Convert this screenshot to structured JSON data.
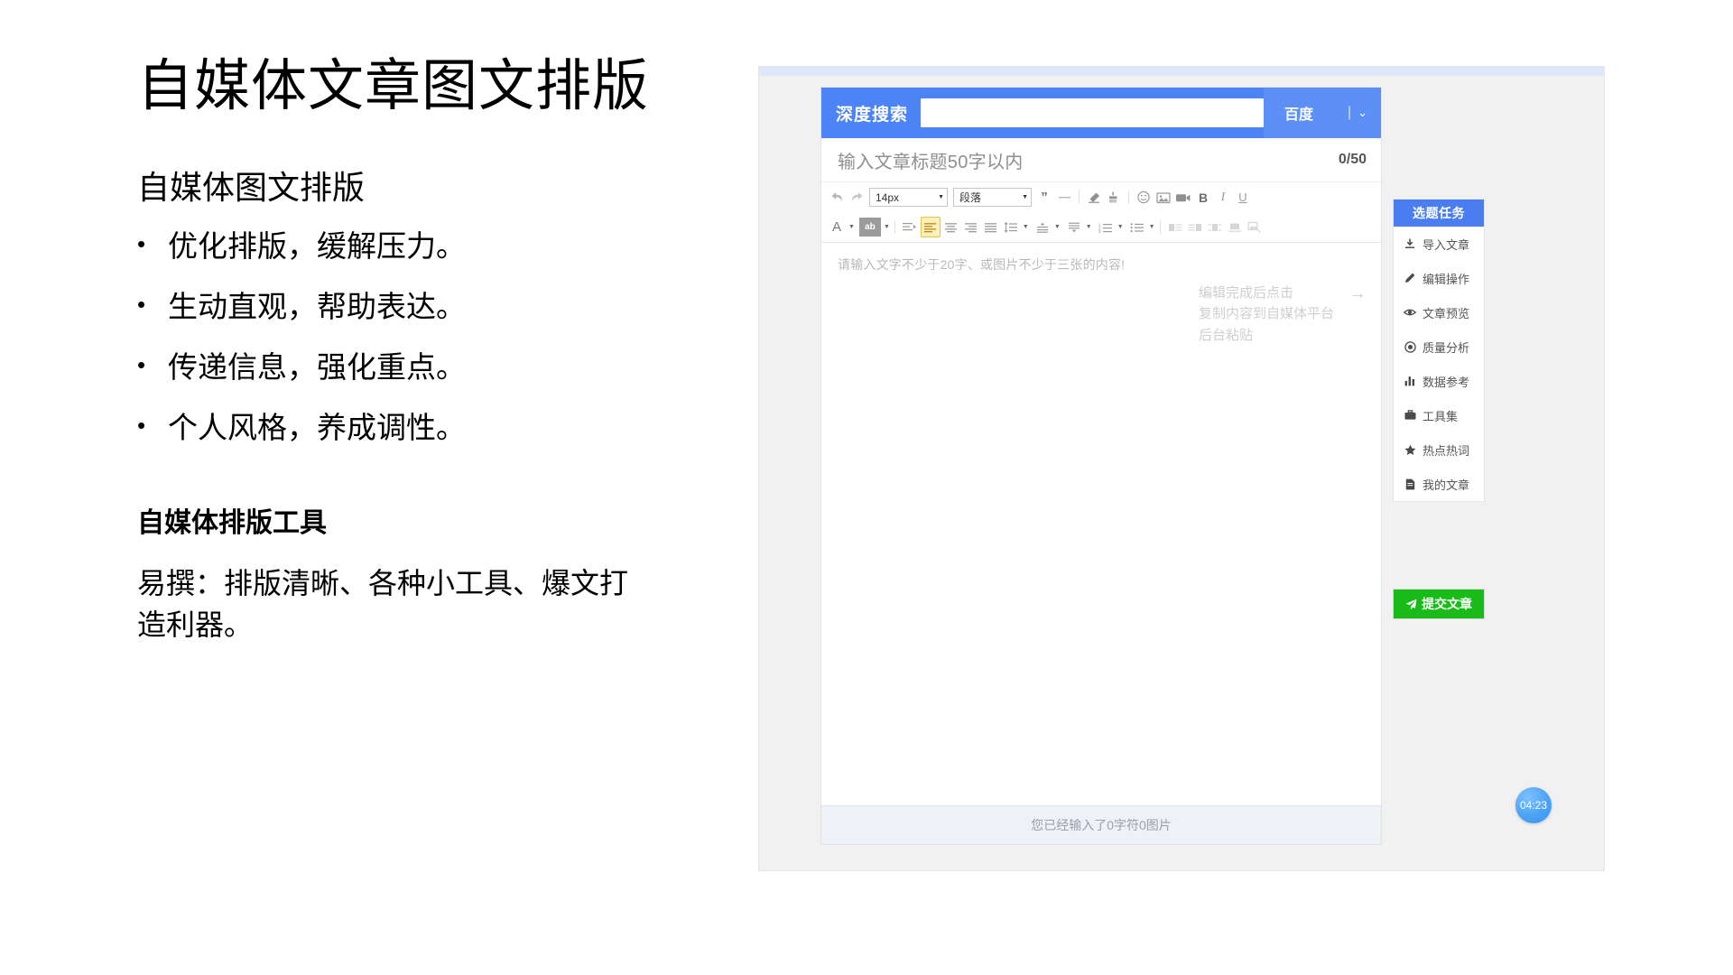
{
  "slide": {
    "title": "自媒体文章图文排版",
    "section_heading": "自媒体图文排版",
    "bullets": [
      "优化排版，缓解压力。",
      "生动直观，帮助表达。",
      "传递信息，强化重点。",
      "个人风格，养成调性。"
    ],
    "bullet_marker": "•",
    "tool_heading": "自媒体排版工具",
    "tool_desc": "易撰：排版清晰、各种小工具、爆文打造利器。"
  },
  "app": {
    "search_header": {
      "brand": "深度搜索",
      "input_value": "",
      "input_placeholder": "",
      "search_button": "百度",
      "divider": "|",
      "chevron": "⌄"
    },
    "title_row": {
      "placeholder": "输入文章标题50字以内",
      "counter": "0/50"
    },
    "toolbar_row1": [
      {
        "name": "undo-icon",
        "label": "↶"
      },
      {
        "name": "redo-icon",
        "label": "↷"
      },
      {
        "name": "font-size-select",
        "label": "14px"
      },
      {
        "name": "paragraph-style-select",
        "label": "段落"
      },
      {
        "name": "blockquote-icon",
        "label": "”"
      },
      {
        "name": "horizontal-rule-icon",
        "label": "—"
      },
      {
        "name": "eraser-icon",
        "label": "eraser"
      },
      {
        "name": "clear-format-icon",
        "label": "brush"
      },
      {
        "name": "emoji-icon",
        "label": "☺"
      },
      {
        "name": "insert-image-icon",
        "label": "image"
      },
      {
        "name": "insert-video-icon",
        "label": "video"
      },
      {
        "name": "bold-icon",
        "label": "B"
      },
      {
        "name": "italic-icon",
        "label": "I"
      },
      {
        "name": "underline-icon",
        "label": "U"
      }
    ],
    "toolbar_row2": [
      {
        "name": "font-color-icon",
        "label": "A"
      },
      {
        "name": "highlight-color-icon",
        "label": "ab"
      },
      {
        "name": "indent-icon",
        "label": "indent"
      },
      {
        "name": "align-left-icon",
        "label": "align-left"
      },
      {
        "name": "align-center-icon",
        "label": "align-center"
      },
      {
        "name": "align-right-icon",
        "label": "align-right"
      },
      {
        "name": "align-justify-icon",
        "label": "align-justify"
      },
      {
        "name": "line-height-icon",
        "label": "line-height"
      },
      {
        "name": "space-before-icon",
        "label": "space-before"
      },
      {
        "name": "space-after-icon",
        "label": "space-after"
      },
      {
        "name": "ordered-list-icon",
        "label": "ordered-list"
      },
      {
        "name": "unordered-list-icon",
        "label": "unordered-list"
      },
      {
        "name": "image-float-left-icon",
        "label": "float-left"
      },
      {
        "name": "image-float-right-icon",
        "label": "float-right"
      },
      {
        "name": "image-inline-icon",
        "label": "inline"
      },
      {
        "name": "image-center-icon",
        "label": "center"
      },
      {
        "name": "image-settings-icon",
        "label": "settings"
      }
    ],
    "editor": {
      "placeholder": "请输入文字不少于20字、或图片不少于三张的内容!",
      "hint_lines": [
        "编辑完成后点击",
        "复制内容到自媒体平台",
        "后台粘贴"
      ],
      "hint_arrow": "→"
    },
    "status_bar": "您已经输入了0字符0图片",
    "sidebar": {
      "header": "选题任务",
      "items": [
        {
          "label": "导入文章",
          "icon": "import-icon"
        },
        {
          "label": "编辑操作",
          "icon": "pencil-icon"
        },
        {
          "label": "文章预览",
          "icon": "eye-icon"
        },
        {
          "label": "质量分析",
          "icon": "target-icon"
        },
        {
          "label": "数据参考",
          "icon": "bar-chart-icon"
        },
        {
          "label": "工具集",
          "icon": "briefcase-icon"
        },
        {
          "label": "热点热词",
          "icon": "star-icon"
        },
        {
          "label": "我的文章",
          "icon": "document-icon"
        }
      ],
      "submit_button": "提交文章",
      "submit_icon": "paper-plane-icon"
    }
  },
  "time_badge": "04:23",
  "colors": {
    "header_blue": "#4c84f5",
    "sidebar_head_blue": "#4a7df0",
    "submit_green": "#19bb19",
    "active_highlight": "#fff0b8",
    "badge_blue": "#4aa3f5"
  }
}
